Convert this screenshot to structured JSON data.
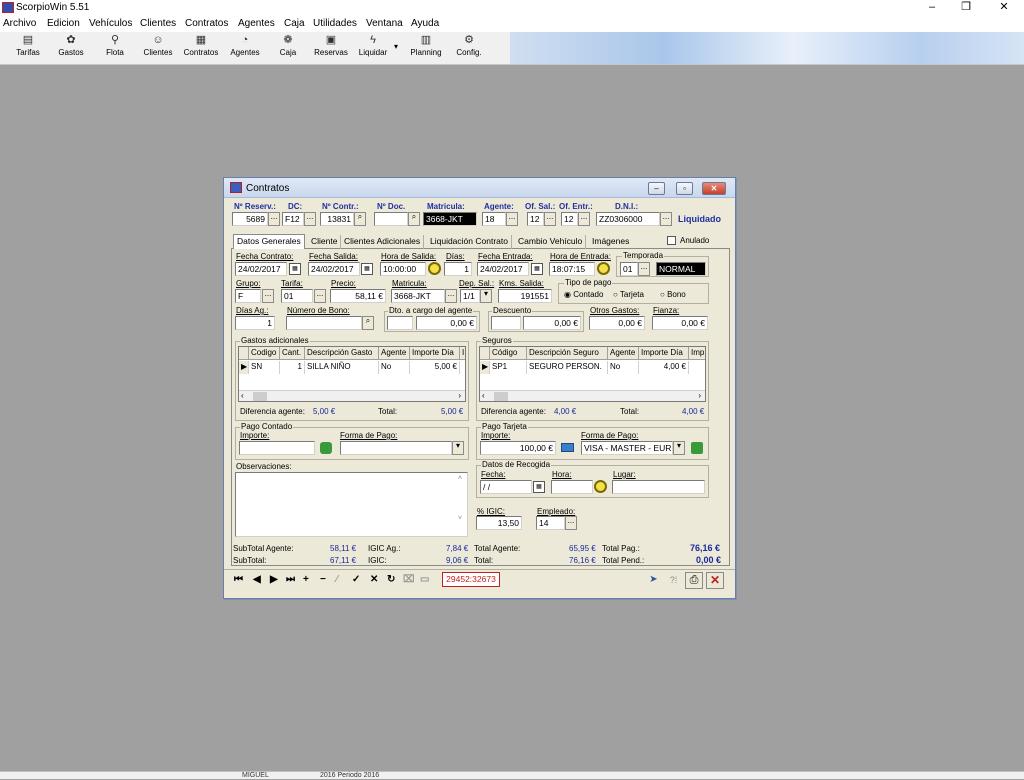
{
  "app": {
    "title": "ScorpioWin 5.51",
    "minimize": "–",
    "maximize": "❐",
    "close": "✕"
  },
  "menu": [
    "Archivo",
    "Edicion",
    "Vehículos",
    "Clientes",
    "Contratos",
    "Agentes",
    "Caja",
    "Utilidades",
    "Ventana",
    "Ayuda"
  ],
  "toolbar": [
    {
      "label": "Tarifas",
      "icon": "tariffs-icon"
    },
    {
      "label": "Gastos",
      "icon": "expenses-icon"
    },
    {
      "label": "Flota",
      "icon": "fleet-icon"
    },
    {
      "label": "Clientes",
      "icon": "clients-icon"
    },
    {
      "label": "Contratos",
      "icon": "contracts-icon"
    },
    {
      "label": "Agentes",
      "icon": "agents-icon"
    },
    {
      "label": "Caja",
      "icon": "cashbox-icon"
    },
    {
      "label": "Reservas",
      "icon": "reservations-icon"
    },
    {
      "label": "Liquidar",
      "icon": "settle-icon"
    },
    {
      "label": "Planning",
      "icon": "planning-icon"
    },
    {
      "label": "Config.",
      "icon": "config-icon"
    }
  ],
  "window": {
    "title": "Contratos",
    "icon": "contracts-window-icon"
  },
  "header": {
    "labels": {
      "reserv": "Nº Reserv.:",
      "dc": "DC:",
      "contr": "Nº Contr.:",
      "doc": "Nº Doc.",
      "matricula": "Matricula:",
      "agente": "Agente:",
      "of_sal": "Of. Sal.:",
      "of_entr": "Of. Entr.:",
      "dni": "D.N.I.:"
    },
    "values": {
      "reserv": "5689",
      "dc": "F12",
      "contr": "13831",
      "doc": "",
      "matricula": "3668-JKT",
      "agente": "18",
      "of_sal": "12",
      "of_entr": "12",
      "dni": "ZZ0306000"
    },
    "status": "Liquidado"
  },
  "tabs": [
    "Datos Generales",
    "Cliente",
    "Clientes Adicionales",
    "Liquidación Contrato",
    "Cambio Vehículo",
    "Imágenes"
  ],
  "anulado": {
    "label": "Anulado",
    "checked": false
  },
  "general": {
    "labels": {
      "fecha_contrato": "Fecha Contrato:",
      "fecha_salida": "Fecha Salida:",
      "hora_salida": "Hora de Salida:",
      "dias": "Días:",
      "fecha_entrada": "Fecha Entrada:",
      "hora_entrada": "Hora de Entrada:",
      "temporada": "Temporada",
      "grupo": "Grupo:",
      "tarifa": "Tarifa:",
      "precio": "Precio:",
      "matricula": "Matricula:",
      "dep_sal": "Dep. Sal.:",
      "kms_salida": "Kms. Salida:",
      "tipo_pago": "Tipo de pago",
      "dias_ag": "Días Ag.:",
      "num_bono": "Número de Bono:",
      "dto_agente": "Dto. a cargo del agente",
      "descuento": "Descuento",
      "otros_gastos": "Otros Gastos:",
      "fianza": "Fianza:"
    },
    "values": {
      "fecha_contrato": "24/02/2017",
      "fecha_salida": "24/02/2017",
      "hora_salida": "10:00:00",
      "dias": "1",
      "fecha_entrada": "24/02/2017",
      "hora_entrada": "18:07:15",
      "temporada_code": "01",
      "temporada_name": "NORMAL",
      "grupo": "F",
      "tarifa": "01",
      "precio": "58,11 €",
      "matricula": "3668-JKT",
      "dep_sal": "1/1",
      "kms_salida": "191551",
      "dias_ag": "1",
      "num_bono": "",
      "dto_agente_pct": "",
      "dto_agente": "0,00 €",
      "descuento_pct": "",
      "descuento": "0,00 €",
      "otros_gastos": "0,00 €",
      "fianza": "0,00 €"
    },
    "tipo_pago_options": [
      "Contado",
      "Tarjeta",
      "Bono"
    ],
    "tipo_pago_selected": "Contado"
  },
  "gastos": {
    "title": "Gastos adicionales",
    "columns": [
      "Codigo",
      "Cant.",
      "Descripción Gasto",
      "Agente",
      "Importe Día",
      "I"
    ],
    "rows": [
      [
        "SN",
        "1",
        "SILLA NIÑO",
        "No",
        "5,00 €",
        ""
      ]
    ],
    "diff_label": "Diferencia agente:",
    "diff": "5,00 €",
    "total_label": "Total:",
    "total": "5,00 €"
  },
  "seguros": {
    "title": "Seguros",
    "columns": [
      "Código",
      "Descripción Seguro",
      "Agente",
      "Importe Día",
      "Imp"
    ],
    "rows": [
      [
        "SP1",
        "SEGURO PERSON.",
        "No",
        "4,00 €",
        ""
      ]
    ],
    "diff_label": "Diferencia agente:",
    "diff": "4,00 €",
    "total_label": "Total:",
    "total": "4,00 €"
  },
  "pago_contado": {
    "title": "Pago Contado",
    "importe_label": "Importe:",
    "importe": "",
    "forma_label": "Forma de Pago:",
    "forma": ""
  },
  "pago_tarjeta": {
    "title": "Pago Tarjeta",
    "importe_label": "Importe:",
    "importe": "100,00 €",
    "forma_label": "Forma de Pago:",
    "forma": "VISA - MASTER - EUR"
  },
  "observaciones": {
    "label": "Observaciones:",
    "value": ""
  },
  "recogida": {
    "title": "Datos de Recogida",
    "fecha_label": "Fecha:",
    "fecha": " / /",
    "hora_label": "Hora:",
    "hora": "",
    "lugar_label": "Lugar:",
    "lugar": ""
  },
  "igic": {
    "label": "% IGIC:",
    "value": "13,50"
  },
  "empleado": {
    "label": "Empleado:",
    "value": "14"
  },
  "totals": {
    "subtotal_agente_label": "SubTotal Agente:",
    "subtotal_agente": "58,11 €",
    "igic_ag_label": "IGIC Ag.:",
    "igic_ag": "7,84 €",
    "total_agente_label": "Total Agente:",
    "total_agente": "65,95 €",
    "total_pag_label": "Total Pag.:",
    "total_pag": "76,16 €",
    "subtotal_label": "SubTotal:",
    "subtotal": "67,11 €",
    "igic_label": "IGIC:",
    "igic": "9,06 €",
    "total_label": "Total:",
    "total": "76,16 €",
    "total_pend_label": "Total Pend.:",
    "total_pend": "0,00 €"
  },
  "navigator": {
    "record_info": "29452:32673"
  },
  "statusbar": {
    "user": "MIGUEL",
    "period": "2016 Periodo 2016"
  },
  "colors": {
    "desktop": "#a0a0a0",
    "dialog": "#ece9d8",
    "label_blue": "#2030a0",
    "value_blue": "#1a2a9a",
    "record_red": "#c02020"
  }
}
